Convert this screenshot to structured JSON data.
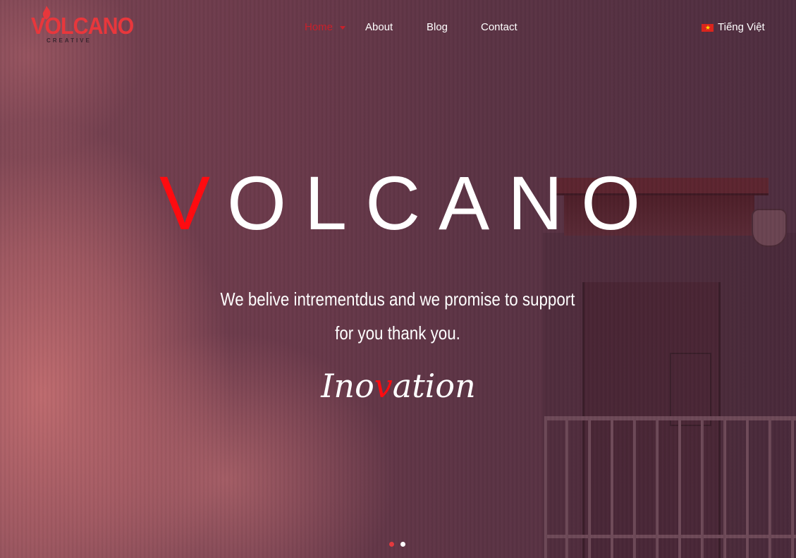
{
  "brand": {
    "logo_text": "VOLCANO",
    "logo_sub": "CREATIVE",
    "accent_color": "#ff0b10"
  },
  "nav": {
    "items": [
      {
        "label": "Home",
        "active": true,
        "has_dropdown": true
      },
      {
        "label": "About"
      },
      {
        "label": "Blog"
      },
      {
        "label": "Contact"
      }
    ]
  },
  "language": {
    "label": "Tiếng Việt",
    "flag_icon": "vietnam-flag-icon"
  },
  "hero": {
    "title_first": "V",
    "title_rest": "OLCANO",
    "tagline_line1": "We belive intrementdus and we promise to support",
    "tagline_line2": "for you thank you.",
    "script_pre": "Ino",
    "script_accent": "v",
    "script_post": "ation"
  },
  "slider": {
    "total": 2,
    "active_index": 1
  }
}
